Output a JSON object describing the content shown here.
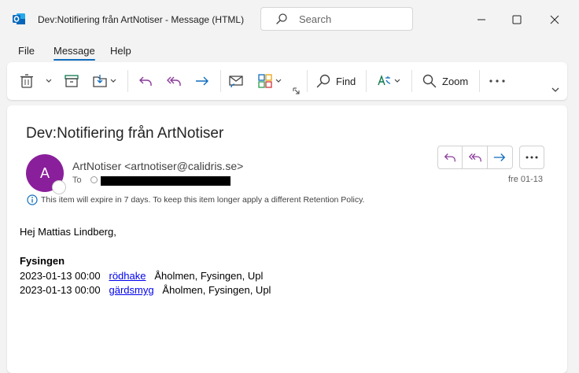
{
  "window": {
    "title": "Dev:Notifiering från ArtNotiser  -  Message (HTML)",
    "search_placeholder": "Search"
  },
  "menu": {
    "tabs": [
      "File",
      "Message",
      "Help"
    ],
    "active": "Message"
  },
  "ribbon": {
    "find_label": "Find",
    "zoom_label": "Zoom"
  },
  "message": {
    "subject": "Dev:Notifiering från ArtNotiser",
    "avatar_letter": "A",
    "avatar_color": "#8a1f9c",
    "sender": "ArtNotiser <artnotiser@calidris.se>",
    "to_label": "To",
    "date": "fre 01-13",
    "retention_notice": "This item will expire in 7 days. To keep this item longer apply a different Retention Policy.",
    "greeting": "Hej Mattias Lindberg,",
    "location_heading": "Fysingen",
    "observations": [
      {
        "datetime": "2023-01-13 00:00",
        "species": "rödhake",
        "place": "Åholmen, Fysingen, Upl"
      },
      {
        "datetime": "2023-01-13 00:00",
        "species": "gärdsmyg",
        "place": "Åholmen, Fysingen, Upl"
      }
    ]
  },
  "colors": {
    "accent": "#0f6cbd",
    "reply": "#8a3a9a",
    "forward": "#0f6cbd",
    "link": "#0000ee"
  }
}
